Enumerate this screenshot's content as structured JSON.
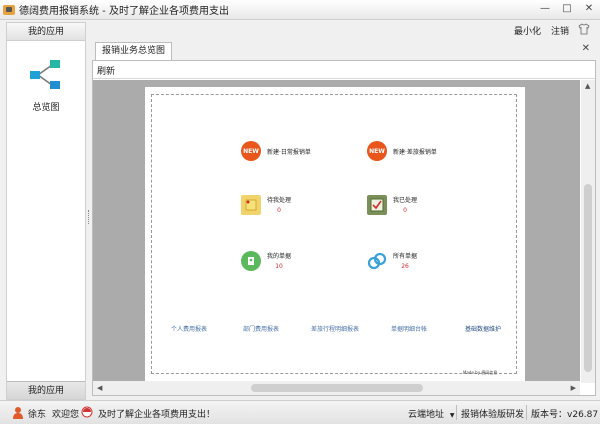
{
  "window": {
    "title": "德阔费用报销系统 - 及时了解企业各项费用支出",
    "minimize_glyph": "—",
    "restore_glyph": "□",
    "close_glyph": "✕"
  },
  "topbar": {
    "minimize_label": "最小化",
    "logout_label": "注销",
    "skin_icon": "shirt-icon"
  },
  "sidebar": {
    "header": "我的应用",
    "overview_label": "总览图",
    "footer": "我的应用"
  },
  "tabs": [
    {
      "label": "报销业务总览图",
      "active": true
    }
  ],
  "toolbar": {
    "refresh_label": "刷新"
  },
  "overview": {
    "tiles": [
      {
        "label": "新建·日常报销单",
        "icon": "new-badge-icon",
        "badge": "NEW",
        "color": "#e8561c"
      },
      {
        "label": "新建·差旅报销单",
        "icon": "new-badge-icon",
        "badge": "NEW",
        "color": "#e8561c"
      },
      {
        "label": "待我处理",
        "count": "0",
        "icon": "pending-note-icon",
        "color": "#f2c94c"
      },
      {
        "label": "我已处理",
        "count": "0",
        "icon": "done-check-icon",
        "color": "#6a8f3a"
      },
      {
        "label": "我的单据",
        "count": "10",
        "icon": "document-icon",
        "color": "#5cb85c"
      },
      {
        "label": "所有单据",
        "count": "26",
        "icon": "chain-link-icon",
        "color": "#3aa0d8"
      }
    ],
    "links": [
      "个人费用报表",
      "部门费用报表",
      "差旅行程明细报表",
      "单据明细台帐",
      "基础数据维护"
    ],
    "signature": "Made by 德阔信息"
  },
  "statusbar": {
    "user": "徐东",
    "welcome": "欢迎您",
    "slogan": "及时了解企业各项费用支出！",
    "cloud_address": "云端地址",
    "dev_note": "报销体验版研发",
    "version_label": "版本号：",
    "version": "v26.87"
  }
}
